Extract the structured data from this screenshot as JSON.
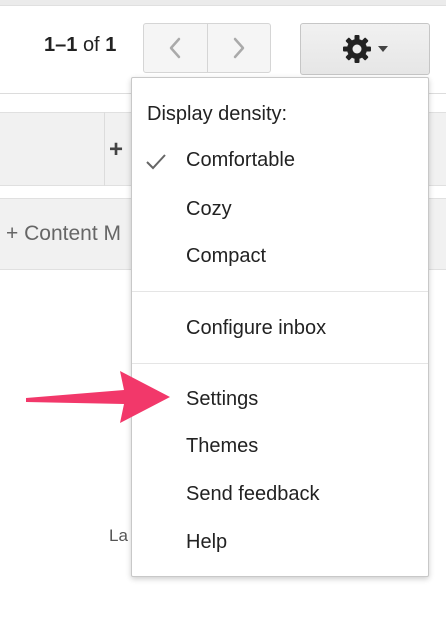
{
  "pager": {
    "range": "1–1",
    "of": "of",
    "total": "1"
  },
  "tabs": {
    "add_symbol": "+"
  },
  "content_row": {
    "label": "+ Content M"
  },
  "footer": {
    "fragment": "La"
  },
  "settings_menu": {
    "density_heading": "Display density:",
    "density_options": [
      {
        "label": "Comfortable",
        "checked": true
      },
      {
        "label": "Cozy",
        "checked": false
      },
      {
        "label": "Compact",
        "checked": false
      }
    ],
    "configure_inbox": "Configure inbox",
    "settings": "Settings",
    "themes": "Themes",
    "send_feedback": "Send feedback",
    "help": "Help"
  },
  "icons": {
    "prev": "chevron-left-icon",
    "next": "chevron-right-icon",
    "settings": "gear-icon",
    "dropdown": "caret-down-icon",
    "check": "check-icon",
    "annotation": "arrow-icon"
  },
  "colors": {
    "annotation_arrow": "#f2386a",
    "menu_border": "#c8c8c8",
    "toolbar_bg": "#f1f1f1"
  }
}
